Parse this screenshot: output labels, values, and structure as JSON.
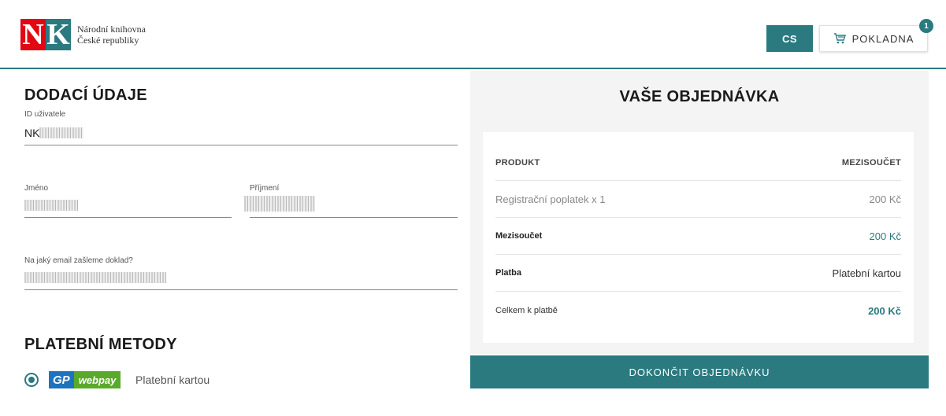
{
  "header": {
    "logo_line1": "Národní knihovna",
    "logo_line2": "České republiky",
    "logo_n": "N",
    "logo_k": "K",
    "lang_label": "CS",
    "cart_label": "POKLADNA",
    "cart_count": "1"
  },
  "delivery": {
    "title": "DODACÍ ÚDAJE",
    "user_id_label": "ID uživatele",
    "user_id_value": "NK",
    "first_name_label": "Jméno",
    "last_name_label": "Příjmení",
    "email_label": "Na jaký email zašleme doklad?"
  },
  "payment_methods": {
    "title": "PLATEBNÍ METODY",
    "gp_text": "GP",
    "webpay_text": "webpay",
    "option_label": "Platební kartou"
  },
  "order": {
    "title": "VAŠE OBJEDNÁVKA",
    "col_product": "PRODUKT",
    "col_subtotal": "MEZISOUČET",
    "item_name": "Registrační poplatek x 1",
    "item_price": "200 Kč",
    "subtotal_label": "Mezisoučet",
    "subtotal_value": "200 Kč",
    "payment_label": "Platba",
    "payment_value": "Platební kartou",
    "total_label": "Celkem k platbě",
    "total_value": "200 Kč"
  },
  "actions": {
    "finish_label": "DOKONČIT OBJEDNÁVKU"
  },
  "colors": {
    "accent": "#2a7a80",
    "brand_red": "#e30613"
  }
}
